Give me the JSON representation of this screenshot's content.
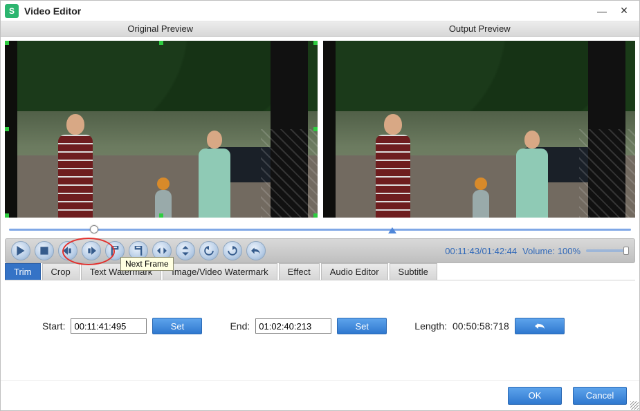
{
  "window": {
    "title": "Video Editor"
  },
  "previews": {
    "original_label": "Original Preview",
    "output_label": "Output Preview"
  },
  "timeline": {
    "playhead_pct": 13,
    "out_marker_pct": 61
  },
  "controls": {
    "tooltip": "Next Frame",
    "status_time": "00:11:43/01:42:44",
    "volume_label": "Volume:",
    "volume_pct": "100%",
    "volume_value": 100,
    "icons": [
      "play",
      "stop",
      "prev-frame",
      "next-frame",
      "mark-in",
      "mark-out",
      "goto-in-out",
      "flip-v",
      "rotate-ccw",
      "rotate-cw",
      "undo"
    ]
  },
  "tabs": [
    {
      "id": "trim",
      "label": "Trim",
      "active": true
    },
    {
      "id": "crop",
      "label": "Crop",
      "active": false
    },
    {
      "id": "text",
      "label": "Text Watermark",
      "active": false
    },
    {
      "id": "image",
      "label": "Image/Video Watermark",
      "active": false
    },
    {
      "id": "effect",
      "label": "Effect",
      "active": false
    },
    {
      "id": "audio",
      "label": "Audio Editor",
      "active": false
    },
    {
      "id": "subtitle",
      "label": "Subtitle",
      "active": false
    }
  ],
  "trim": {
    "start_label": "Start:",
    "start_value": "00:11:41:495",
    "end_label": "End:",
    "end_value": "01:02:40:213",
    "length_label": "Length:",
    "length_value": "00:50:58:718",
    "set_label": "Set"
  },
  "footer": {
    "ok": "OK",
    "cancel": "Cancel"
  }
}
